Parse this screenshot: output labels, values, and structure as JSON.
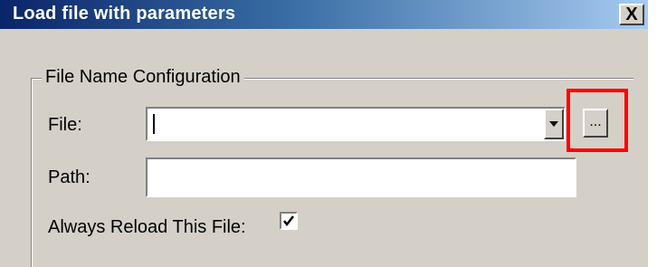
{
  "window": {
    "title": "Load file with parameters",
    "close_symbol": "X"
  },
  "group": {
    "label": "File Name Configuration"
  },
  "file": {
    "label": "File:",
    "value": "",
    "browse_label": "..."
  },
  "path": {
    "label": "Path:",
    "value": ""
  },
  "reload": {
    "label": "Always Reload This File:",
    "checked": true
  },
  "colors": {
    "highlight": "#ff0000",
    "dialog_bg": "#d4d0c8"
  },
  "icons": {
    "dropdown": "chevron-down-icon",
    "check": "checkmark-icon"
  }
}
